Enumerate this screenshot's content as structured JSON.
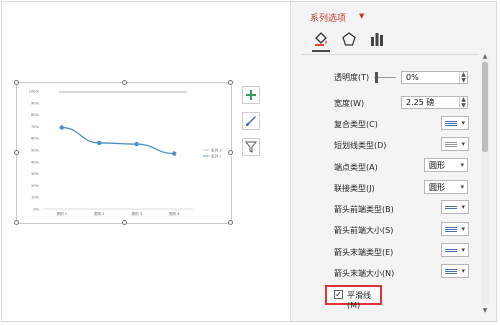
{
  "panel": {
    "title": "系列选项",
    "title_caret": "▼",
    "icons": [
      "fill-bucket-icon",
      "pentagon-icon",
      "bar-chart-icon"
    ]
  },
  "props": [
    {
      "label": "透明度(T)",
      "value": "0%"
    },
    {
      "label": "宽度(W)",
      "value": "2.25 磅"
    },
    {
      "label": "复合类型(C)"
    },
    {
      "label": "短划线类型(D)"
    },
    {
      "label": "端点类型(A)",
      "value": "圆形"
    },
    {
      "label": "联接类型(J)",
      "value": "圆形"
    },
    {
      "label": "箭头前端类型(B)"
    },
    {
      "label": "箭头前端大小(S)"
    },
    {
      "label": "箭头末端类型(E)"
    },
    {
      "label": "箭头末端大小(N)"
    }
  ],
  "smooth_line": {
    "label": "平滑线(M)",
    "checked": true,
    "check_glyph": "✓"
  },
  "chart_data": {
    "type": "line",
    "categories": [
      "类别 1",
      "类别 2",
      "类别 3",
      "类别 4"
    ],
    "series": [
      {
        "name": "系列 1",
        "values": [
          0.69,
          0.56,
          0.55,
          0.47
        ],
        "color": "#4a90c8"
      }
    ],
    "legend": [
      "系列 3",
      "系列 1"
    ],
    "y_ticks": [
      "0%",
      "10%",
      "20%",
      "30%",
      "40%",
      "50%",
      "60%",
      "70%",
      "80%",
      "90%",
      "100%"
    ],
    "ylim": [
      0,
      1
    ],
    "grid": false,
    "legend_position": "right"
  },
  "tools": {
    "add": "plus-icon",
    "style": "brush-icon",
    "filter": "filter-icon"
  },
  "colors": {
    "accent_red": "#c13b2f",
    "highlight_red": "#e03434",
    "series_blue": "#4a90c8",
    "tool_green": "#3a9a5a"
  }
}
